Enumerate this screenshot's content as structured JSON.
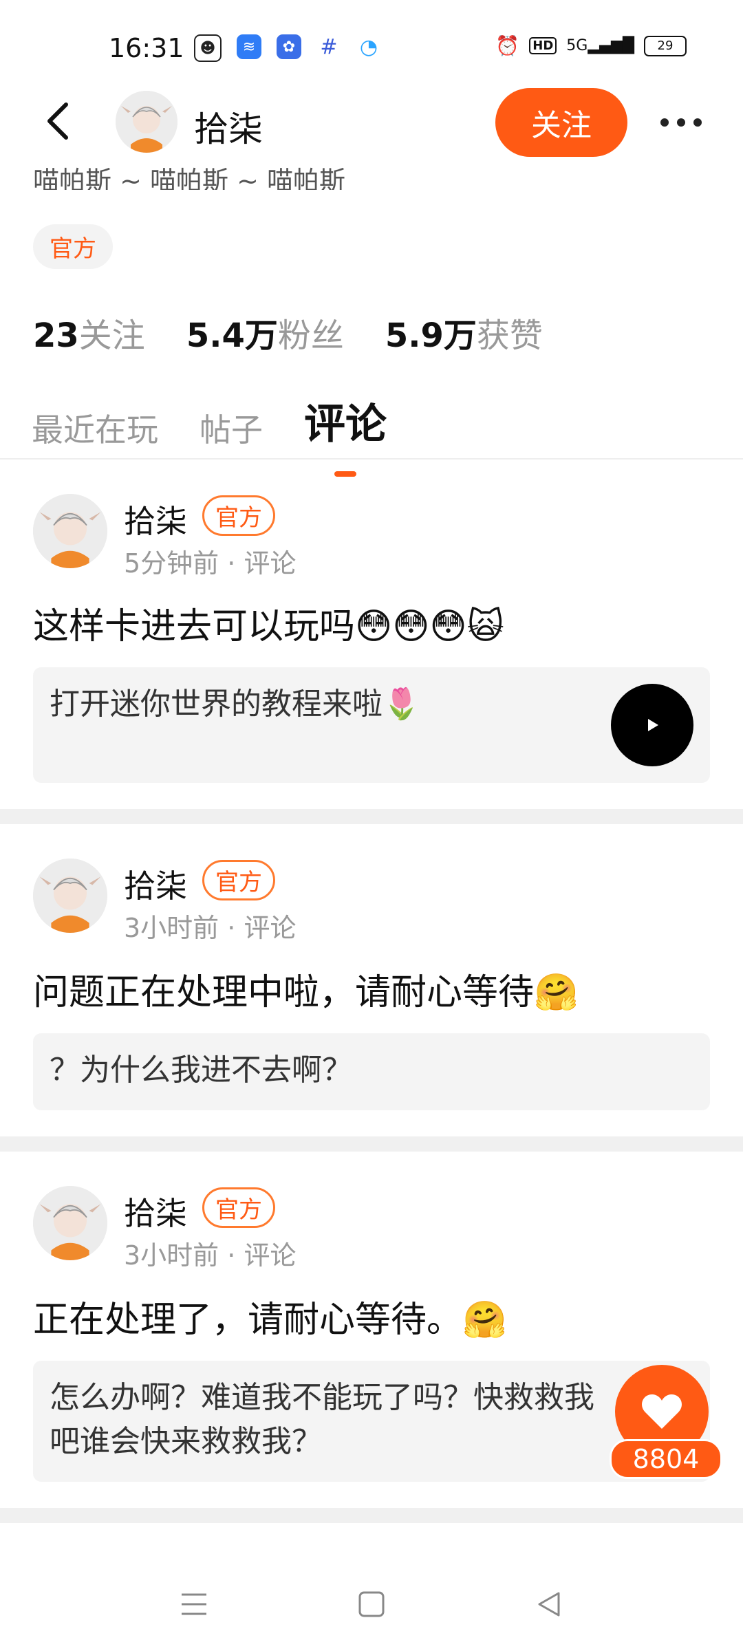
{
  "status_bar": {
    "time": "16:31",
    "network": "5G",
    "battery": "29",
    "hd": "HD",
    "apps": [
      {
        "icon": "panda-app-icon",
        "color": "#ffffff"
      },
      {
        "icon": "wifi-app-icon",
        "color": "#2f7cf6"
      },
      {
        "icon": "baidu-app-icon",
        "color": "#3a6ee8"
      },
      {
        "icon": "hash-app-icon",
        "color": "#ffffff"
      },
      {
        "icon": "browser-app-icon",
        "color": "#2aa4ff"
      }
    ]
  },
  "header": {
    "name": "拾柒",
    "follow_label": "关注"
  },
  "profile": {
    "bio": "喵帕斯 ~ 喵帕斯 ~ 喵帕斯",
    "official_tag": "官方",
    "stats": [
      {
        "value": "23",
        "label": "关注"
      },
      {
        "value": "5.4万",
        "label": "粉丝"
      },
      {
        "value": "5.9万",
        "label": "获赞"
      }
    ]
  },
  "tabs": [
    {
      "label": "最近在玩",
      "active": false
    },
    {
      "label": "帖子",
      "active": false
    },
    {
      "label": "评论",
      "active": true
    }
  ],
  "comments": [
    {
      "name": "拾柒",
      "badge": "官方",
      "time": "5分钟前",
      "type": "评论",
      "text": "这样卡进去可以玩吗😳😳😳🙀",
      "quote": "打开迷你世界的教程来啦🌷"
    },
    {
      "name": "拾柒",
      "badge": "官方",
      "time": "3小时前",
      "type": "评论",
      "text": "问题正在处理中啦，请耐心等待🤗",
      "quote": "？为什么我进不去啊？"
    },
    {
      "name": "拾柒",
      "badge": "官方",
      "time": "3小时前",
      "type": "评论",
      "text": "正在处理了，请耐心等待。🤗",
      "quote": "怎么办啊？难道我不能玩了吗？快救救我吧谁会快来救救我？"
    }
  ],
  "like": {
    "count": "8804"
  },
  "colors": {
    "accent": "#ff5a14"
  }
}
